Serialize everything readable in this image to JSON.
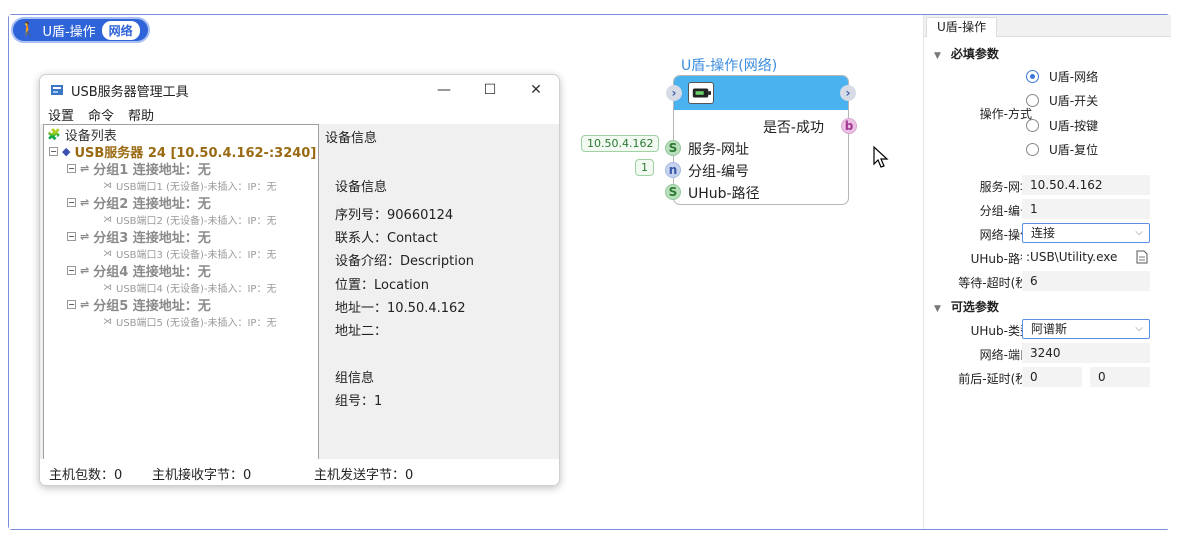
{
  "workflow": {
    "title": "U盾-操作",
    "tag": "网络"
  },
  "usb_window": {
    "title": "USB服务器管理工具",
    "controls": {
      "minimize": "—",
      "maximize": "☐",
      "close": "✕"
    },
    "menu": [
      "设置",
      "命令",
      "帮助"
    ],
    "tree": {
      "root": "设备列表",
      "server": "USB服务器 24 [10.50.4.162-:3240]",
      "groups": [
        {
          "label": "分组1 连接地址：无",
          "port": "USB端口1 (无设备)-未插入：IP：无"
        },
        {
          "label": "分组2 连接地址：无",
          "port": "USB端口2 (无设备)-未插入：IP：无"
        },
        {
          "label": "分组3 连接地址：无",
          "port": "USB端口3 (无设备)-未插入：IP：无"
        },
        {
          "label": "分组4 连接地址：无",
          "port": "USB端口4 (无设备)-未插入：IP：无"
        },
        {
          "label": "分组5 连接地址：无",
          "port": "USB端口5 (无设备)-未插入：IP：无"
        }
      ]
    },
    "info": {
      "header": "设备信息",
      "section_title": "设备信息",
      "serial": "序列号：90660124",
      "contact": "联系人：Contact",
      "description": "设备介绍：Description",
      "location": "位置：Location",
      "address1": "地址一：10.50.4.162",
      "address2": "地址二：",
      "group_title": "组信息",
      "group_no": "组号：1"
    },
    "status": {
      "packets": "主机包数：0",
      "recv_bytes": "主机接收字节：0",
      "send_bytes": "主机发送字节：0"
    }
  },
  "node": {
    "title": "U盾-操作(网络)",
    "output_label": "是否-成功",
    "output_pin": "b",
    "inputs": [
      {
        "pin": "S",
        "label": "服务-网址",
        "value": "10.50.4.162"
      },
      {
        "pin": "n",
        "label": "分组-编号",
        "value": "1"
      },
      {
        "pin": "S",
        "label": "UHub-路径",
        "value": ""
      }
    ]
  },
  "properties": {
    "tab": "U盾-操作",
    "required_title": "必填参数",
    "mode_label": "操作-方式",
    "mode_options": [
      "U盾-网络",
      "U盾-开关",
      "U盾-按键",
      "U盾-复位"
    ],
    "mode_selected": 0,
    "server_url_label": "服务-网址",
    "server_url": "10.50.4.162",
    "group_no_label": "分组-编号",
    "group_no": "1",
    "net_op_label": "网络-操作",
    "net_op": "连接",
    "uhub_path_label": "UHub-路径",
    "uhub_path": ":USB\\Utility.exe",
    "timeout_label": "等待-超时(秒)",
    "timeout": "6",
    "optional_title": "可选参数",
    "uhub_type_label": "UHub-类型",
    "uhub_type": "阿谱斯",
    "net_port_label": "网络-端口",
    "net_port": "3240",
    "delay_label": "前后-延时(秒)",
    "delay_before": "0",
    "delay_after": "0"
  }
}
